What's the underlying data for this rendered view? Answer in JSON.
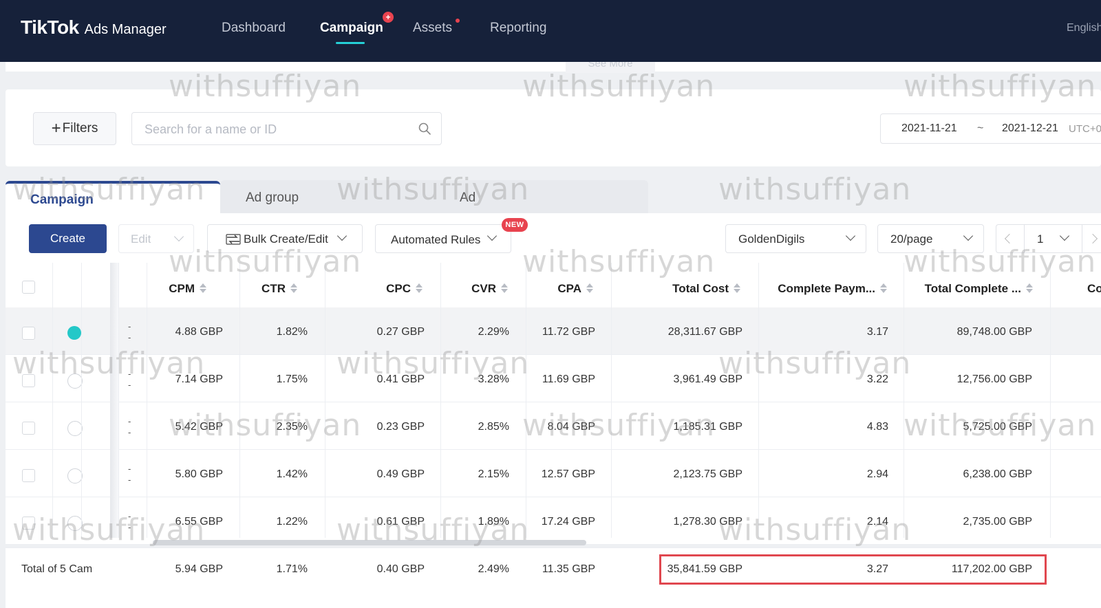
{
  "nav": {
    "logo_main": "TikTok",
    "logo_sub": "Ads Manager",
    "items": [
      "Dashboard",
      "Campaign",
      "Assets",
      "Reporting"
    ],
    "badge": "+",
    "language": "English"
  },
  "see_more": "See More",
  "filters": {
    "button_label": "Filters",
    "search_placeholder": "Search for a name or ID",
    "date_start": "2021-11-21",
    "date_sep": "~",
    "date_end": "2021-12-21",
    "timezone": "UTC+0"
  },
  "tabs": [
    "Campaign",
    "Ad group",
    "Ad"
  ],
  "toolbar": {
    "create": "Create",
    "edit": "Edit",
    "bulk": "Bulk Create/Edit",
    "rules": "Automated Rules",
    "new_badge": "NEW",
    "account": "GoldenDigils",
    "page_size": "20/page",
    "page": "1"
  },
  "table": {
    "headers": [
      "CPM",
      "CTR",
      "CPC",
      "CVR",
      "CPA",
      "Total Cost",
      "Complete Paym...",
      "Total Complete ...",
      "Co"
    ],
    "rows": [
      {
        "status": "on",
        "dash": "-\n-",
        "cpm": "4.88 GBP",
        "ctr": "1.82%",
        "cpc": "0.27 GBP",
        "cvr": "2.29%",
        "cpa": "11.72 GBP",
        "cost": "28,311.67 GBP",
        "roas": "3.17",
        "value": "89,748.00 GBP"
      },
      {
        "status": "off",
        "dash": "-\n-",
        "cpm": "7.14 GBP",
        "ctr": "1.75%",
        "cpc": "0.41 GBP",
        "cvr": "3.28%",
        "cpa": "11.69 GBP",
        "cost": "3,961.49 GBP",
        "roas": "3.22",
        "value": "12,756.00 GBP"
      },
      {
        "status": "off",
        "dash": "-\n-",
        "cpm": "5.42 GBP",
        "ctr": "2.35%",
        "cpc": "0.23 GBP",
        "cvr": "2.85%",
        "cpa": "8.04 GBP",
        "cost": "1,185.31 GBP",
        "roas": "4.83",
        "value": "5,725.00 GBP"
      },
      {
        "status": "off",
        "dash": "-\n-",
        "cpm": "5.80 GBP",
        "ctr": "1.42%",
        "cpc": "0.49 GBP",
        "cvr": "2.15%",
        "cpa": "12.57 GBP",
        "cost": "2,123.75 GBP",
        "roas": "2.94",
        "value": "6,238.00 GBP"
      },
      {
        "status": "off",
        "dash": "-\n-",
        "cpm": "6.55 GBP",
        "ctr": "1.22%",
        "cpc": "0.61 GBP",
        "cvr": "1.89%",
        "cpa": "17.24 GBP",
        "cost": "1,278.30 GBP",
        "roas": "2.14",
        "value": "2,735.00 GBP"
      }
    ],
    "total": {
      "label": "Total of 5 Cam",
      "cpm": "5.94 GBP",
      "ctr": "1.71%",
      "cpc": "0.40 GBP",
      "cvr": "2.49%",
      "cpa": "11.35 GBP",
      "cost": "35,841.59 GBP",
      "roas": "3.27",
      "value": "117,202.00 GBP"
    }
  },
  "watermark": "withsuffiyan",
  "colors": {
    "nav_bg": "#16213a",
    "primary": "#2c4890",
    "accent": "#25d0d6",
    "highlight": "#e0474f"
  }
}
